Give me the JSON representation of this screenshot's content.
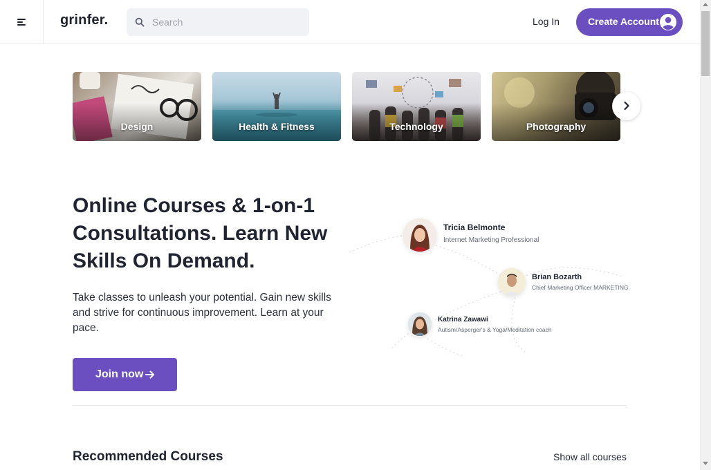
{
  "header": {
    "logo": "grinfer",
    "logo_dot": ".",
    "search_placeholder": "Search",
    "login_label": "Log In",
    "create_account_label": "Create Account"
  },
  "categories": [
    {
      "label": "Design"
    },
    {
      "label": "Health & Fitness"
    },
    {
      "label": "Technology"
    },
    {
      "label": "Photography"
    }
  ],
  "hero": {
    "title_lines": [
      "Online Courses & 1-on-1",
      "Consultations. Learn New",
      "Skills On Demand."
    ],
    "text_lines": [
      "Take classes to unleash your potential. Gain new skills",
      "and strive for continuous improvement. Learn at your",
      "pace."
    ],
    "join_label": "Join now"
  },
  "mentors": [
    {
      "name": "Tricia Belmonte",
      "role": "Internet Marketing Professional"
    },
    {
      "name": "Brian Bozarth",
      "role": "Chief Marketing Officer MARKETING"
    },
    {
      "name": "Katrina Zawawi",
      "role": "Autism/Asperger's & Yoga/Meditation coach"
    }
  ],
  "recommended": {
    "title": "Recommended Courses",
    "show_all_label": "Show all courses"
  },
  "colors": {
    "accent": "#6b4fc1",
    "text": "#1f2430",
    "search_bg": "#f1f2f5"
  }
}
